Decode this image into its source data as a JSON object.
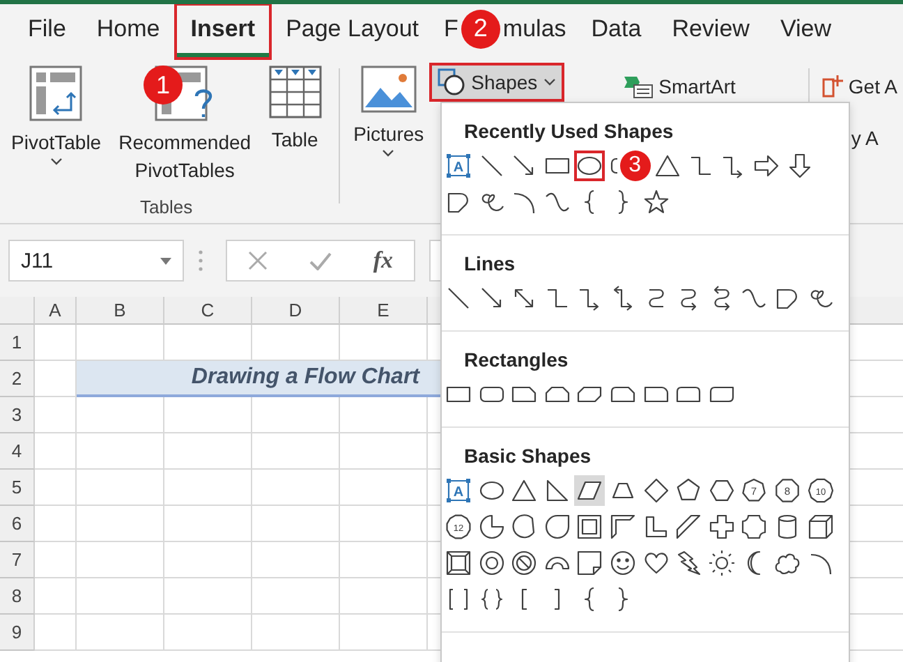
{
  "tabs": [
    {
      "label": "File",
      "selected": false,
      "highlighted": false
    },
    {
      "label": "Home",
      "selected": false,
      "highlighted": false
    },
    {
      "label": "Insert",
      "selected": true,
      "highlighted": true
    },
    {
      "label": "Page Layout",
      "selected": false,
      "highlighted": false
    },
    {
      "label": "F",
      "badge": "2",
      "label_after_badge": "mulas",
      "selected": false,
      "highlighted": false
    },
    {
      "label": "Data",
      "selected": false,
      "highlighted": false
    },
    {
      "label": "Review",
      "selected": false,
      "highlighted": false
    },
    {
      "label": "View",
      "selected": false,
      "highlighted": false
    }
  ],
  "ribbon": {
    "tables_group": {
      "label": "Tables",
      "buttons": [
        {
          "kind": "pivot",
          "label": "PivotTable",
          "dropdown": true
        },
        {
          "kind": "recommended",
          "label": "Recommended PivotTables",
          "dropdown": false
        },
        {
          "kind": "table",
          "label": "Table",
          "dropdown": false
        }
      ]
    },
    "pictures": {
      "label": "Pictures",
      "dropdown": true
    },
    "shapes_button": {
      "label": "Shapes",
      "highlighted": true
    },
    "smartart": {
      "label": "SmartArt"
    },
    "cut_labels": [
      "Get A",
      "y A"
    ]
  },
  "formula_bar": {
    "name_box": "J11",
    "function_label": "fx"
  },
  "sheet": {
    "columns": [
      "A",
      "B",
      "C",
      "D",
      "E"
    ],
    "rows": [
      "1",
      "2",
      "3",
      "4",
      "5",
      "6",
      "7",
      "8",
      "9"
    ],
    "title": "Drawing a Flow Chart"
  },
  "shapes_menu": {
    "sections": [
      {
        "title": "Recently Used Shapes",
        "shapes": [
          {
            "kind": "text-box",
            "label": "A",
            "selected": false,
            "highlighted": false
          },
          {
            "kind": "line",
            "selected": false,
            "highlighted": false
          },
          {
            "kind": "arrow",
            "selected": false,
            "highlighted": false
          },
          {
            "kind": "rectangle",
            "selected": false,
            "highlighted": false
          },
          {
            "kind": "oval",
            "selected": false,
            "highlighted": true
          },
          {
            "kind": "rounded-rectangle",
            "badge": "3",
            "selected": false,
            "highlighted": false
          },
          {
            "kind": "triangle",
            "selected": false,
            "highlighted": false
          },
          {
            "kind": "elbow-connector",
            "selected": false,
            "highlighted": false
          },
          {
            "kind": "elbow-arrow",
            "selected": false,
            "highlighted": false
          },
          {
            "kind": "block-arrow-right",
            "selected": false,
            "highlighted": false
          },
          {
            "kind": "block-arrow-down",
            "selected": false,
            "highlighted": false
          },
          {
            "kind": "freeform",
            "selected": false,
            "highlighted": false
          },
          {
            "kind": "scribble",
            "selected": false,
            "highlighted": false
          },
          {
            "kind": "arc",
            "selected": false,
            "highlighted": false
          },
          {
            "kind": "curve",
            "selected": false,
            "highlighted": false
          },
          {
            "kind": "left-brace",
            "selected": false,
            "highlighted": false
          },
          {
            "kind": "right-brace",
            "selected": false,
            "highlighted": false
          },
          {
            "kind": "star",
            "selected": false,
            "highlighted": false
          }
        ]
      },
      {
        "title": "Lines",
        "shapes": [
          {
            "kind": "line",
            "selected": false
          },
          {
            "kind": "arrow",
            "selected": false
          },
          {
            "kind": "double-arrow",
            "selected": false
          },
          {
            "kind": "elbow-connector",
            "selected": false
          },
          {
            "kind": "elbow-arrow",
            "selected": false
          },
          {
            "kind": "elbow-double-arrow",
            "selected": false
          },
          {
            "kind": "curved-connector",
            "selected": false
          },
          {
            "kind": "curved-arrow",
            "selected": false
          },
          {
            "kind": "curved-double-arrow",
            "selected": false
          },
          {
            "kind": "curve",
            "selected": false
          },
          {
            "kind": "freeform",
            "selected": false
          },
          {
            "kind": "scribble",
            "selected": false
          }
        ]
      },
      {
        "title": "Rectangles",
        "shapes": [
          {
            "kind": "rectangle",
            "selected": false
          },
          {
            "kind": "rounded-rectangle",
            "selected": false
          },
          {
            "kind": "snip-rectangle",
            "selected": false
          },
          {
            "kind": "snip-same-side",
            "selected": false
          },
          {
            "kind": "snip-diagonal",
            "selected": false
          },
          {
            "kind": "snip-round",
            "selected": false
          },
          {
            "kind": "round-single-corner",
            "selected": false
          },
          {
            "kind": "round-same-side",
            "selected": false
          },
          {
            "kind": "round-diagonal",
            "selected": false
          }
        ]
      },
      {
        "title": "Basic Shapes",
        "shapes": [
          {
            "kind": "text-box",
            "label": "A",
            "selected": false
          },
          {
            "kind": "oval",
            "selected": false
          },
          {
            "kind": "triangle",
            "selected": false
          },
          {
            "kind": "right-triangle",
            "selected": false
          },
          {
            "kind": "parallelogram",
            "selected": true
          },
          {
            "kind": "trapezoid",
            "selected": false
          },
          {
            "kind": "diamond",
            "selected": false
          },
          {
            "kind": "pentagon",
            "selected": false
          },
          {
            "kind": "hexagon",
            "selected": false
          },
          {
            "kind": "heptagon",
            "label": "7",
            "selected": false
          },
          {
            "kind": "octagon",
            "label": "8",
            "selected": false
          },
          {
            "kind": "decagon",
            "label": "10",
            "selected": false
          },
          {
            "kind": "dodecagon",
            "label": "12",
            "selected": false
          },
          {
            "kind": "pie",
            "selected": false
          },
          {
            "kind": "chord",
            "selected": false
          },
          {
            "kind": "teardrop",
            "selected": false
          },
          {
            "kind": "frame",
            "selected": false
          },
          {
            "kind": "half-frame",
            "selected": false
          },
          {
            "kind": "l-shape",
            "selected": false
          },
          {
            "kind": "diagonal-stripe",
            "selected": false
          },
          {
            "kind": "plus",
            "selected": false
          },
          {
            "kind": "plaque",
            "selected": false
          },
          {
            "kind": "can",
            "selected": false
          },
          {
            "kind": "cube",
            "selected": false
          },
          {
            "kind": "bevel",
            "selected": false
          },
          {
            "kind": "donut",
            "selected": false
          },
          {
            "kind": "no-symbol",
            "selected": false
          },
          {
            "kind": "block-arc",
            "selected": false
          },
          {
            "kind": "folded-corner",
            "selected": false
          },
          {
            "kind": "smiley",
            "selected": false
          },
          {
            "kind": "heart",
            "selected": false
          },
          {
            "kind": "lightning",
            "selected": false
          },
          {
            "kind": "sun",
            "selected": false
          },
          {
            "kind": "moon",
            "selected": false
          },
          {
            "kind": "cloud",
            "selected": false
          },
          {
            "kind": "arc",
            "selected": false
          },
          {
            "kind": "double-bracket",
            "selected": false
          },
          {
            "kind": "double-brace",
            "selected": false
          },
          {
            "kind": "left-bracket",
            "selected": false
          },
          {
            "kind": "right-bracket",
            "selected": false
          },
          {
            "kind": "left-brace",
            "selected": false
          },
          {
            "kind": "right-brace",
            "selected": false
          }
        ]
      }
    ]
  },
  "badges": [
    {
      "label": "1"
    }
  ]
}
